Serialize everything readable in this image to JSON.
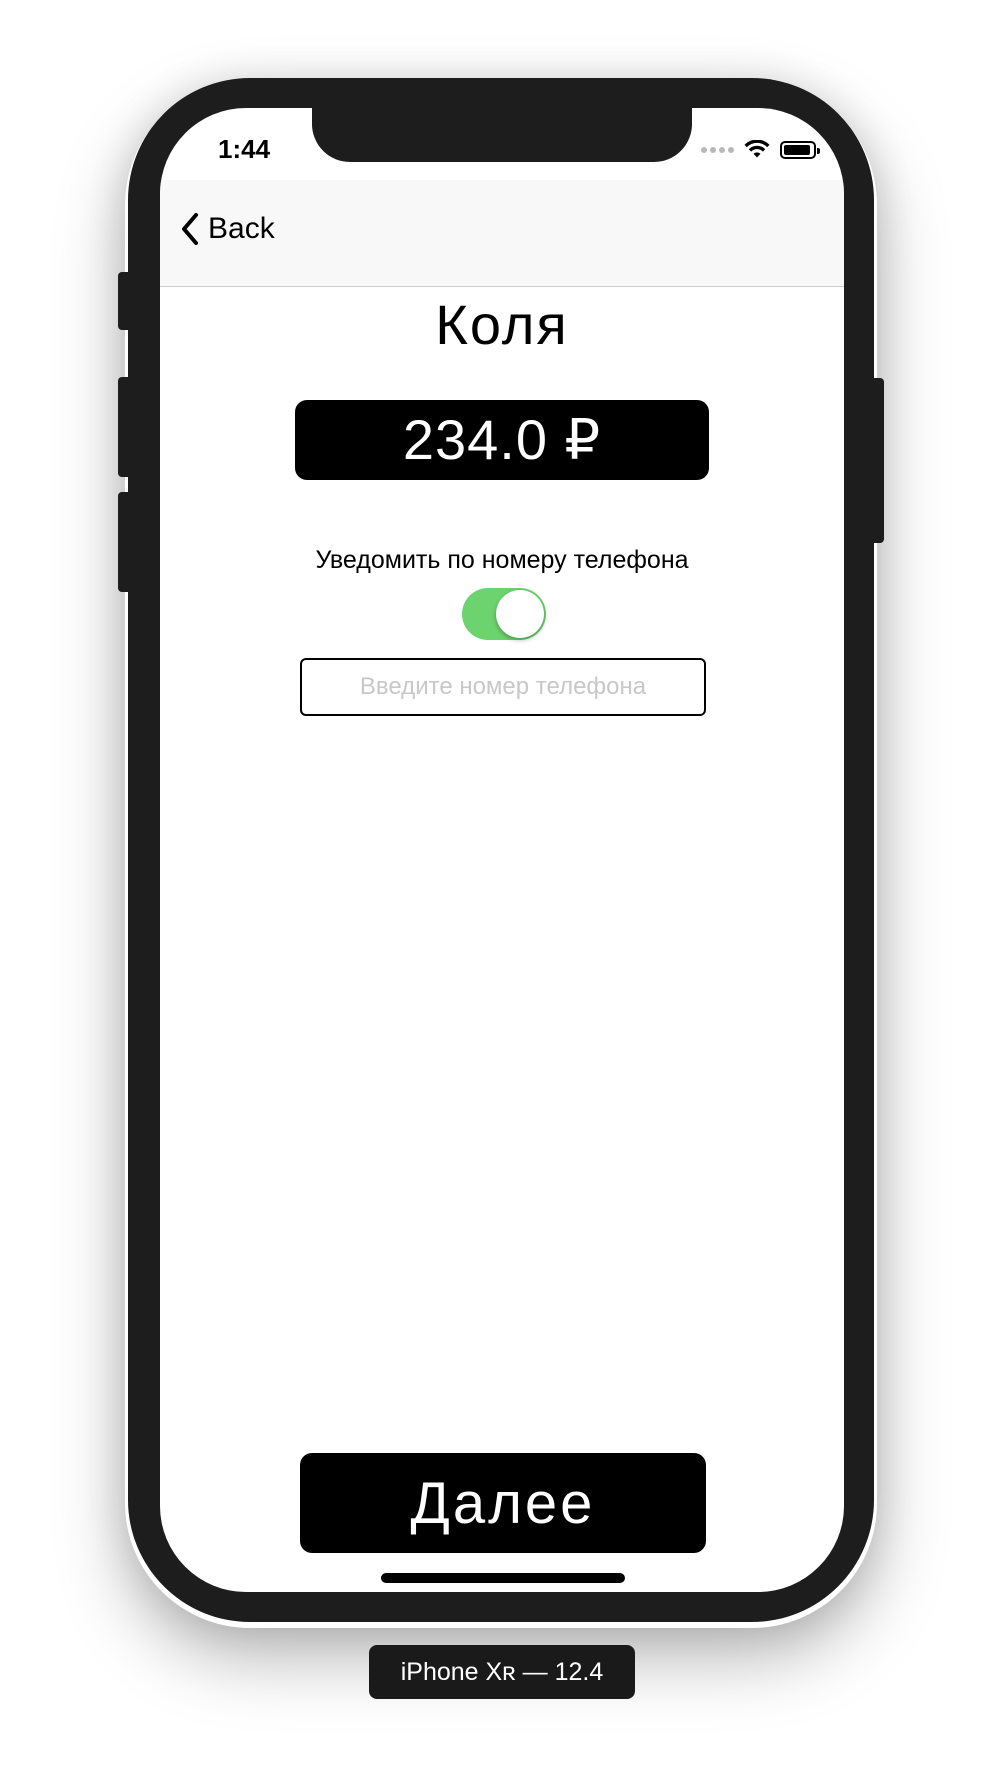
{
  "status_bar": {
    "time": "1:44",
    "icons": [
      "signal-dots-icon",
      "wifi-icon",
      "battery-icon"
    ]
  },
  "navbar": {
    "back_label": "Back",
    "back_icon": "chevron-left-icon"
  },
  "main": {
    "title": "Коля",
    "amount": "234.0 ₽",
    "notify_label": "Уведомить по номеру телефона",
    "notify_toggle_on": true,
    "phone_input": {
      "value": "",
      "placeholder": "Введите номер телефона"
    },
    "next_label": "Далее"
  },
  "device_label": "iPhone Xʀ — 12.4",
  "colors": {
    "toggle_on": "#6dd36e",
    "amount_bg": "#000000",
    "button_bg": "#000000",
    "placeholder": "#c7c7cc"
  }
}
